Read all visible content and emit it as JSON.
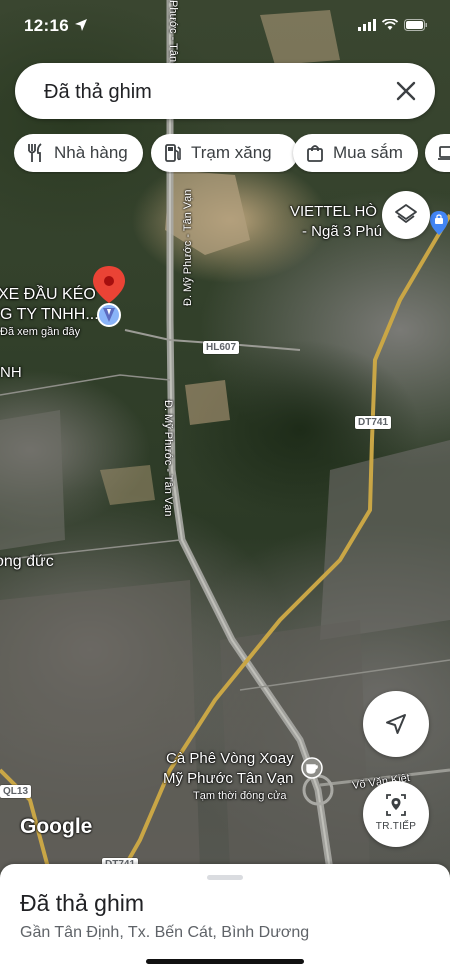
{
  "status_bar": {
    "time": "12:16"
  },
  "search": {
    "query": "Đã thả ghim"
  },
  "chips": [
    {
      "label": "Nhà hàng",
      "icon": "restaurant-icon"
    },
    {
      "label": "Trạm xăng",
      "icon": "gas-station-icon"
    },
    {
      "label": "Mua sắm",
      "icon": "shopping-bag-icon"
    },
    {
      "label": "",
      "icon": "laptop-icon"
    }
  ],
  "map_labels": {
    "pin_place_line1": "XE ĐẦU KÉO",
    "pin_place_line2": "G TY TNHH...",
    "pin_place_note": "Đã xem gần đây",
    "area_nh": "NH",
    "area_long_duc": "ong đức",
    "viettel_line1": "VIETTEL HÒ",
    "viettel_line2": "- Ngã 3 Phú",
    "cafe_line1": "Cà Phê Vòng Xoay",
    "cafe_line2": "Mỹ Phước Tân Vạn",
    "cafe_status": "Tạm thời đóng cửa",
    "road_my_phuoc_top": "Phước - Tân",
    "road_my_phuoc_mid": "Đ. Mỹ Phước - Tân Vạn",
    "road_my_phuoc_low": "Đ. Mỹ Phước - Tân Vạn",
    "road_vo": "Võ Văn Kiệt",
    "shield_hl607": "HL607",
    "shield_dt741": "DT741",
    "shield_ql13": "QL13",
    "shield_dt741_bottom": "DT741",
    "google": "Google"
  },
  "buttons": {
    "directions_label": "TR.TIẾP"
  },
  "place_sheet": {
    "title": "Đã thả ghim",
    "address": "Gần Tân Định, Tx. Bến Cát, Bình Dương"
  },
  "colors": {
    "pin_red": "#ea4335",
    "road_yellow": "#c9a646",
    "shop_pin_blue": "#4285f4"
  }
}
